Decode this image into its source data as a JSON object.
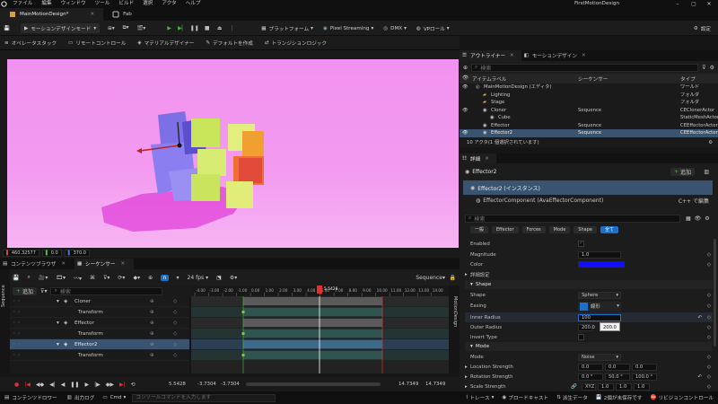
{
  "menu": {
    "items": [
      "ファイル",
      "編集",
      "ウィンドウ",
      "ツール",
      "ビルド",
      "選択",
      "アクタ",
      "ヘルプ"
    ],
    "project_title": "FirstMotionDesign"
  },
  "tabs": [
    {
      "label": "MainMotionDesign*"
    },
    {
      "label": "Fab"
    }
  ],
  "toolbar": {
    "mode": "モーションデザインモード",
    "platform": "プラットフォーム",
    "pixel_streaming": "Pixel Streaming",
    "dmx": "DMX",
    "vp_role": "VPロール",
    "settings": "設定"
  },
  "toolbar2": {
    "items": [
      "オペレータスタック",
      "リモートコントロール",
      "マテリアルデザイナー",
      "デフォルトを作成",
      "トランジションロジック"
    ]
  },
  "viewport": {
    "status_x": "460.32577",
    "status_y": "0.0",
    "status_z": "370.0"
  },
  "sequencer": {
    "tabs": [
      "コンテンツブラウザ",
      "シーケンサー"
    ],
    "add_label": "追加",
    "search_placeholder": "検索",
    "fps": "24 fps",
    "sequence_name": "Sequence",
    "time_marker": "5.5428",
    "current_time": "5.5428",
    "range_start_a": "-3.7304",
    "range_start_b": "-3.7304",
    "range_end_a": "14.7349",
    "range_end_b": "14.7349",
    "ruler_ticks": [
      "-4.00",
      "-3.00",
      "-2.00",
      "-1.00",
      "0.00",
      "1.00",
      "2.00",
      "3.00",
      "4.00",
      "6.00",
      "7.00",
      "8.00",
      "9.00",
      "10.00",
      "11.00",
      "12.00",
      "13.00",
      "14.00"
    ],
    "tracks": [
      {
        "label": "Cloner",
        "indent": 1,
        "selected": false
      },
      {
        "label": "Transform",
        "indent": 2,
        "selected": false
      },
      {
        "label": "Effector",
        "indent": 1,
        "selected": false
      },
      {
        "label": "Transform",
        "indent": 2,
        "selected": false
      },
      {
        "label": "Effector2",
        "indent": 1,
        "selected": true
      },
      {
        "label": "Transform",
        "indent": 2,
        "selected": false
      }
    ],
    "side_label": "Sequence",
    "right_label": "MotionDesign"
  },
  "outliner": {
    "tabs": [
      "アウトライナー",
      "モーションデザイン"
    ],
    "search_placeholder": "検索",
    "col_label": "アイテムラベル",
    "col_sequencer": "シーケンサー",
    "col_type": "タイプ",
    "rows": [
      {
        "label": "MainMotionDesign (エディタ)",
        "seq": "",
        "type": "ワールド",
        "indent": 0,
        "selected": false
      },
      {
        "label": "Lighting",
        "seq": "",
        "type": "フォルダ",
        "indent": 1,
        "selected": false
      },
      {
        "label": "Stage",
        "seq": "",
        "type": "フォルダ",
        "indent": 1,
        "selected": false
      },
      {
        "label": "Cloner",
        "seq": "Sequence",
        "type": "CEClonerActor",
        "indent": 1,
        "selected": false
      },
      {
        "label": "Cube",
        "seq": "",
        "type": "StaticMeshActor",
        "indent": 2,
        "selected": false
      },
      {
        "label": "Effector",
        "seq": "Sequence",
        "type": "CEEffectorActor",
        "indent": 1,
        "selected": false
      },
      {
        "label": "Effector2",
        "seq": "Sequence",
        "type": "CEEffectorActor",
        "indent": 1,
        "selected": true
      }
    ],
    "footer": "10 アクタ(1 個選択されています)"
  },
  "details": {
    "tab": "詳細",
    "actor_name": "Effector2",
    "add_label": "追加",
    "instance_label": "Effector2 (インスタンス)",
    "component_label": "EffectorComponent (AvaEffectorComponent)",
    "cpp_label": "C++ で編集",
    "search_placeholder": "検索",
    "filters": [
      "一般",
      "Effector",
      "Forces",
      "Mode",
      "Shape",
      "全て"
    ],
    "props": {
      "enabled_label": "Enabled",
      "magnitude_label": "Magnitude",
      "magnitude_value": "1.0",
      "color_label": "Color",
      "advanced_label": "詳細設定",
      "shape_section": "Shape",
      "shape_label": "Shape",
      "shape_value": "Sphere",
      "easing_label": "Easing",
      "easing_value": "線形",
      "inner_radius_label": "Inner Radius",
      "inner_radius_value": "100",
      "outer_radius_label": "Outer Radius",
      "outer_radius_value": "200.0",
      "outer_radius_tooltip": "200.0",
      "invert_label": "Invert Type",
      "mode_section": "Mode",
      "mode_label": "Mode",
      "mode_value": "Noise",
      "location_label": "Location Strength",
      "location_x": "0.0",
      "location_y": "0.0",
      "location_z": "0.0",
      "rotation_label": "Rotation Strength",
      "rotation_x": "0.0 °",
      "rotation_y": "50.0 °",
      "rotation_z": "100.0 °",
      "scale_label": "Scale Strength",
      "scale_xyz": "XYZ",
      "scale_x": "1.0",
      "scale_y": "1.0",
      "scale_z": "1.0"
    }
  },
  "statusbar": {
    "content_drawer": "コンテンツドロワー",
    "output_log": "出力ログ",
    "cmd": "Cmd",
    "console_placeholder": "コンソールコマンドを入力します",
    "trace": "トレース",
    "broadcast": "ブロードキャスト",
    "derived_data": "派生データ",
    "unsaved": "2個が未保存です",
    "revision": "リビジョンコントロール"
  },
  "colors": {
    "accent": "#1b70c9",
    "selection": "#3a5470",
    "viewport_bg": "#f292f0",
    "effector_color": "#1010ff",
    "playhead": "#e03030"
  }
}
